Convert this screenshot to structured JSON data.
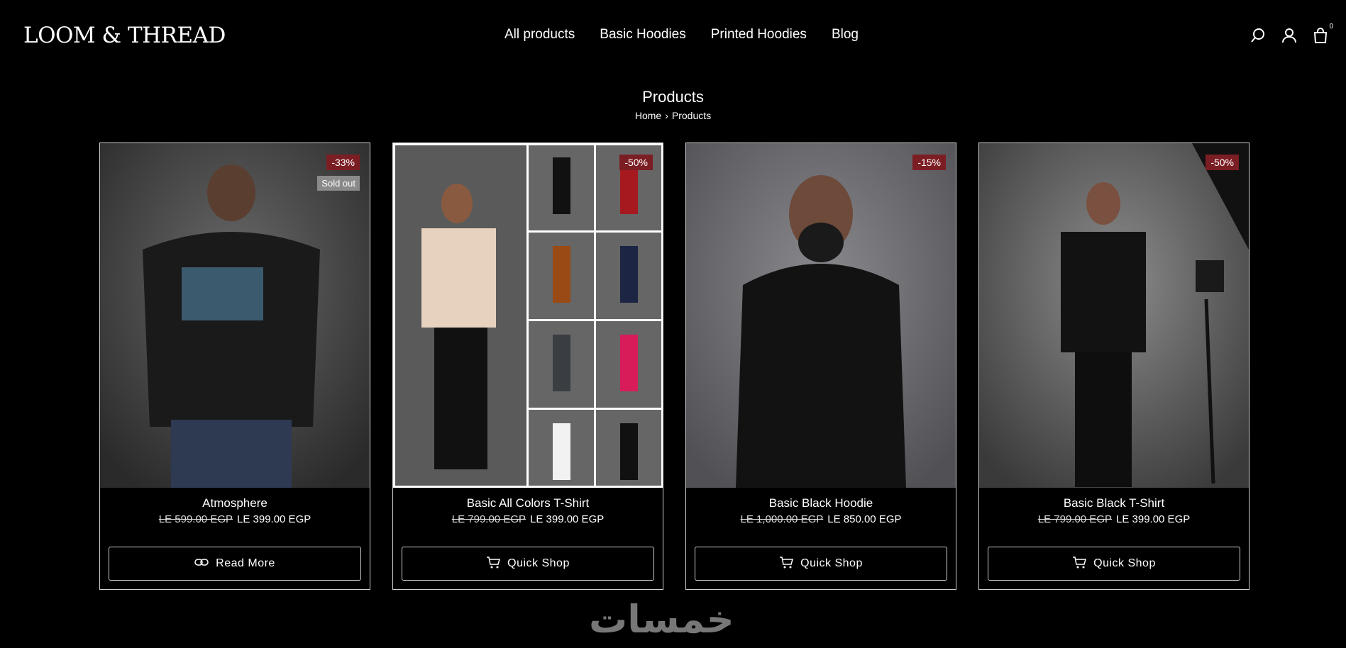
{
  "header": {
    "logo": "LOOM & THREAD",
    "nav": [
      "All products",
      "Basic Hoodies",
      "Printed Hoodies",
      "Blog"
    ],
    "cart_count": "0",
    "icons": [
      "search-icon",
      "user-icon",
      "cart-icon"
    ]
  },
  "page": {
    "title": "Products",
    "breadcrumb": [
      "Home",
      "Products"
    ]
  },
  "products": [
    {
      "name": "Atmosphere",
      "old_price": "LE 599.00 EGP",
      "price": "LE 399.00 EGP",
      "badge": "-33%",
      "sold_out": "Sold out",
      "button": "Read More"
    },
    {
      "name": "Basic All Colors T-Shirt",
      "old_price": "LE 799.00 EGP",
      "price": "LE 399.00 EGP",
      "badge": "-50%",
      "button": "Quick Shop"
    },
    {
      "name": "Basic Black Hoodie",
      "old_price": "LE 1,000.00 EGP",
      "price": "LE 850.00 EGP",
      "badge": "-15%",
      "button": "Quick Shop"
    },
    {
      "name": "Basic Black T-Shirt",
      "old_price": "LE 799.00 EGP",
      "price": "LE 399.00 EGP",
      "badge": "-50%",
      "button": "Quick Shop"
    }
  ],
  "watermark": "خمسات",
  "colors": {
    "badge": "#7b1e24",
    "sold_out": "#8a8a8a",
    "background": "#000000"
  }
}
